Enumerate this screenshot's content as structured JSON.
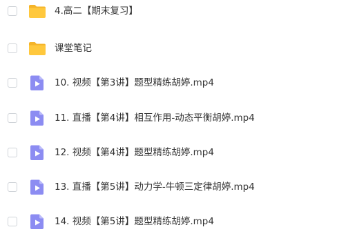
{
  "file_list": {
    "items": [
      {
        "name": "4.高二【期末复习】",
        "type": "folder"
      },
      {
        "name": "课堂笔记",
        "type": "folder"
      },
      {
        "name": "10. 视频【第3讲】题型精练胡婷.mp4",
        "type": "video"
      },
      {
        "name": "11. 直播【第4讲】相互作用-动态平衡胡婷.mp4",
        "type": "video"
      },
      {
        "name": "12. 视频【第4讲】题型精练胡婷.mp4",
        "type": "video"
      },
      {
        "name": "13. 直播【第5讲】动力学-牛顿三定律胡婷.mp4",
        "type": "video"
      },
      {
        "name": "14. 视频【第5讲】题型精练胡婷.mp4",
        "type": "video"
      }
    ]
  },
  "icons": {
    "folder": "folder-icon",
    "video": "video-file-icon"
  },
  "colors": {
    "folder": "#ffc83d",
    "folder_tab": "#f5b429",
    "video_file": "#8c8cf2",
    "video_fold": "#bcbcfa",
    "play": "#ffffff",
    "checkbox_border": "#cfd3d8",
    "text": "#333333"
  }
}
